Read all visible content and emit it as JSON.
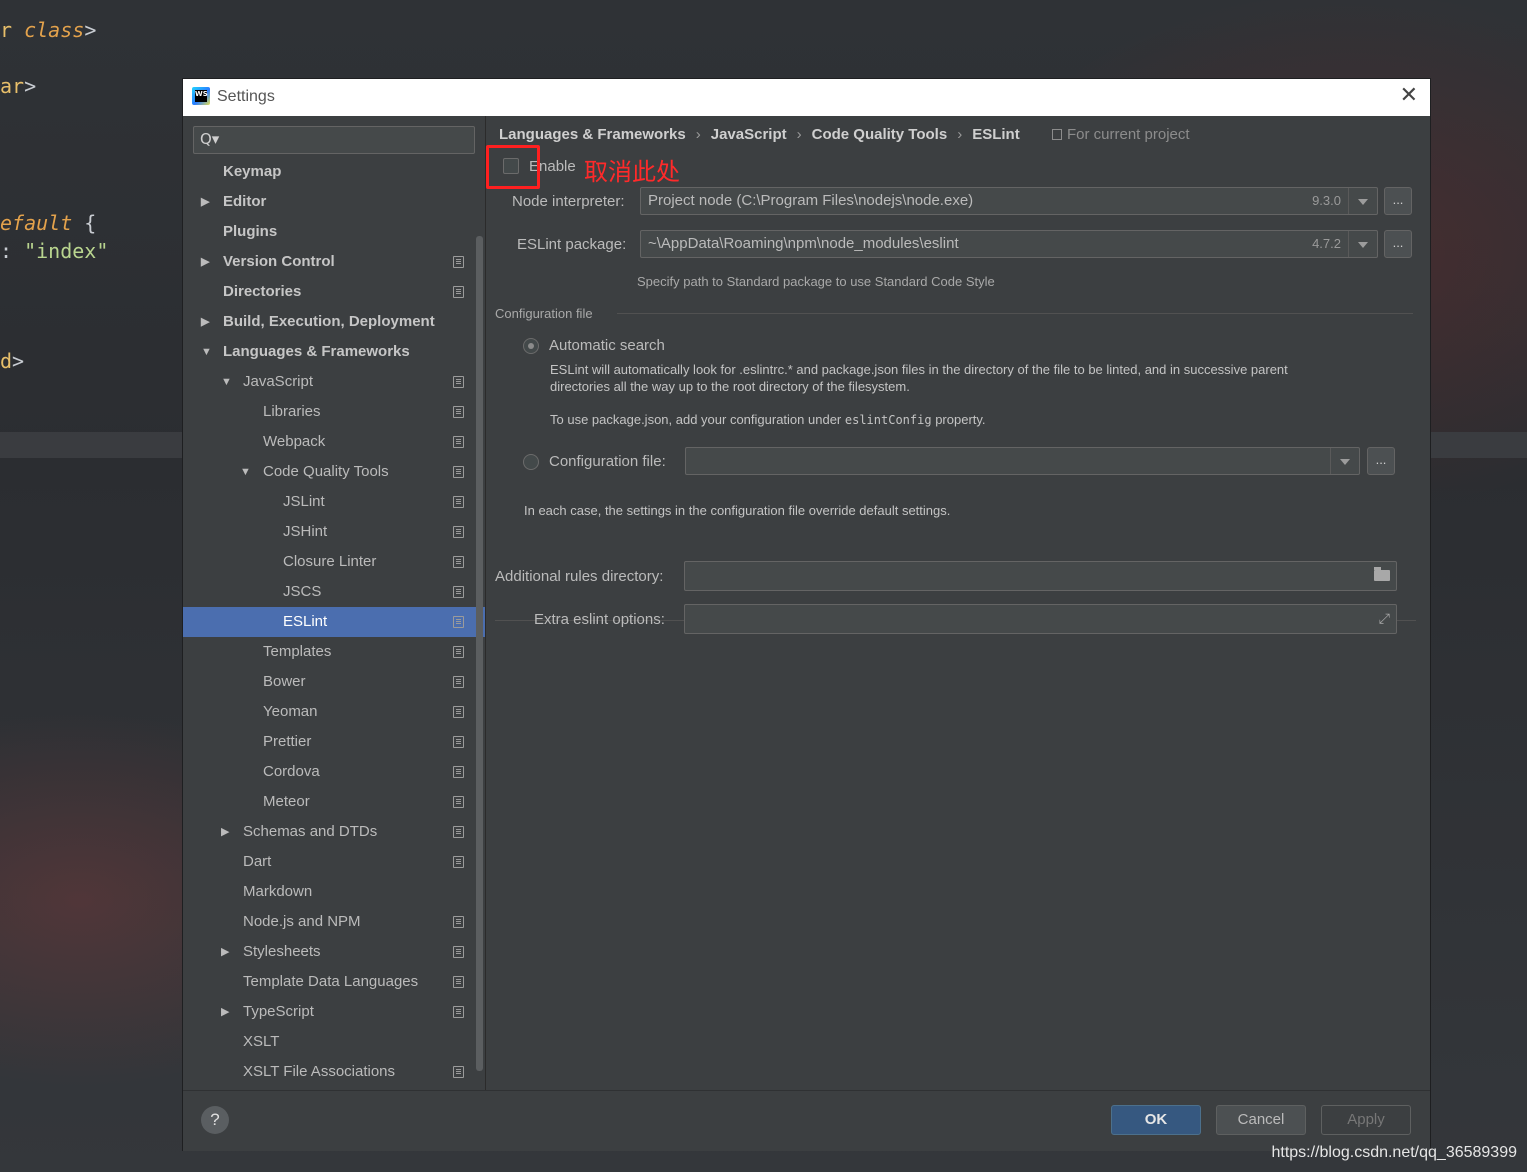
{
  "background_code": [
    {
      "a": "r ",
      "b": "class",
      "c": ">"
    },
    {
      "a": "ar",
      "b": "",
      "c": ">"
    },
    {
      "a": "efault ",
      "b": "",
      "c": "{"
    },
    {
      "a": ": ",
      "b": "\"index\"",
      "c": ""
    },
    {
      "a": "d",
      "b": "",
      "c": ">"
    }
  ],
  "dialog": {
    "title": "Settings",
    "close_glyph": "✕"
  },
  "search": {
    "placeholder": "",
    "icon": "Q▾"
  },
  "tree": [
    {
      "label": "Keymap",
      "bold": true,
      "indent": 0,
      "arrow": "",
      "proj": false
    },
    {
      "label": "Editor",
      "bold": true,
      "indent": 0,
      "arrow": "▶",
      "proj": false
    },
    {
      "label": "Plugins",
      "bold": true,
      "indent": 0,
      "arrow": "",
      "proj": false
    },
    {
      "label": "Version Control",
      "bold": true,
      "indent": 0,
      "arrow": "▶",
      "proj": true
    },
    {
      "label": "Directories",
      "bold": true,
      "indent": 0,
      "arrow": "",
      "proj": true
    },
    {
      "label": "Build, Execution, Deployment",
      "bold": true,
      "indent": 0,
      "arrow": "▶",
      "proj": false
    },
    {
      "label": "Languages & Frameworks",
      "bold": true,
      "indent": 0,
      "arrow": "▼",
      "proj": false
    },
    {
      "label": "JavaScript",
      "bold": false,
      "indent": 1,
      "arrow": "▼",
      "proj": true
    },
    {
      "label": "Libraries",
      "bold": false,
      "indent": 2,
      "arrow": "",
      "proj": true
    },
    {
      "label": "Webpack",
      "bold": false,
      "indent": 2,
      "arrow": "",
      "proj": true
    },
    {
      "label": "Code Quality Tools",
      "bold": false,
      "indent": 2,
      "arrow": "▼",
      "proj": true
    },
    {
      "label": "JSLint",
      "bold": false,
      "indent": 3,
      "arrow": "",
      "proj": true
    },
    {
      "label": "JSHint",
      "bold": false,
      "indent": 3,
      "arrow": "",
      "proj": true
    },
    {
      "label": "Closure Linter",
      "bold": false,
      "indent": 3,
      "arrow": "",
      "proj": true
    },
    {
      "label": "JSCS",
      "bold": false,
      "indent": 3,
      "arrow": "",
      "proj": true
    },
    {
      "label": "ESLint",
      "bold": false,
      "indent": 3,
      "arrow": "",
      "proj": true,
      "selected": true
    },
    {
      "label": "Templates",
      "bold": false,
      "indent": 2,
      "arrow": "",
      "proj": true
    },
    {
      "label": "Bower",
      "bold": false,
      "indent": 2,
      "arrow": "",
      "proj": true
    },
    {
      "label": "Yeoman",
      "bold": false,
      "indent": 2,
      "arrow": "",
      "proj": true
    },
    {
      "label": "Prettier",
      "bold": false,
      "indent": 2,
      "arrow": "",
      "proj": true
    },
    {
      "label": "Cordova",
      "bold": false,
      "indent": 2,
      "arrow": "",
      "proj": true
    },
    {
      "label": "Meteor",
      "bold": false,
      "indent": 2,
      "arrow": "",
      "proj": true
    },
    {
      "label": "Schemas and DTDs",
      "bold": false,
      "indent": 1,
      "arrow": "▶",
      "proj": true
    },
    {
      "label": "Dart",
      "bold": false,
      "indent": 1,
      "arrow": "",
      "proj": true
    },
    {
      "label": "Markdown",
      "bold": false,
      "indent": 1,
      "arrow": "",
      "proj": false
    },
    {
      "label": "Node.js and NPM",
      "bold": false,
      "indent": 1,
      "arrow": "",
      "proj": true
    },
    {
      "label": "Stylesheets",
      "bold": false,
      "indent": 1,
      "arrow": "▶",
      "proj": true
    },
    {
      "label": "Template Data Languages",
      "bold": false,
      "indent": 1,
      "arrow": "",
      "proj": true
    },
    {
      "label": "TypeScript",
      "bold": false,
      "indent": 1,
      "arrow": "▶",
      "proj": true
    },
    {
      "label": "XSLT",
      "bold": false,
      "indent": 1,
      "arrow": "",
      "proj": false
    },
    {
      "label": "XSLT File Associations",
      "bold": false,
      "indent": 1,
      "arrow": "",
      "proj": true
    }
  ],
  "breadcrumb": {
    "items": [
      "Languages & Frameworks",
      "JavaScript",
      "Code Quality Tools",
      "ESLint"
    ],
    "sep": "›",
    "for_project": "For current project"
  },
  "enable": {
    "label": "Enable",
    "checked": false,
    "annotation": "取消此处"
  },
  "node_interpreter": {
    "label": "Node interpreter:",
    "value": "Project  node (C:\\Program Files\\nodejs\\node.exe)",
    "version": "9.3.0",
    "browse": "..."
  },
  "eslint_package": {
    "label": "ESLint package:",
    "value": "~\\AppData\\Roaming\\npm\\node_modules\\eslint",
    "version": "4.7.2",
    "browse": "...",
    "hint": "Specify path to Standard package to use Standard Code Style"
  },
  "config": {
    "section_title": "Configuration file",
    "auto_label": "Automatic search",
    "auto_selected": true,
    "auto_desc_1": "ESLint will automatically look for .eslintrc.* and package.json files in the directory of the file to be linted, and in successive parent",
    "auto_desc_2": "directories all the way up to the root directory of the filesystem.",
    "auto_desc_3_pre": "To use package.json, add your configuration under ",
    "auto_desc_3_code": "eslintConfig",
    "auto_desc_3_post": " property.",
    "file_label": "Configuration file:",
    "file_value": "",
    "file_browse": "...",
    "override_note": "In each case, the settings in the configuration file override default settings."
  },
  "additional_rules": {
    "label": "Additional rules directory:",
    "value": ""
  },
  "extra_options": {
    "label": "Extra eslint options:",
    "value": ""
  },
  "footer": {
    "help": "?",
    "ok": "OK",
    "cancel": "Cancel",
    "apply": "Apply"
  },
  "watermark": "https://blog.csdn.net/qq_36589399"
}
